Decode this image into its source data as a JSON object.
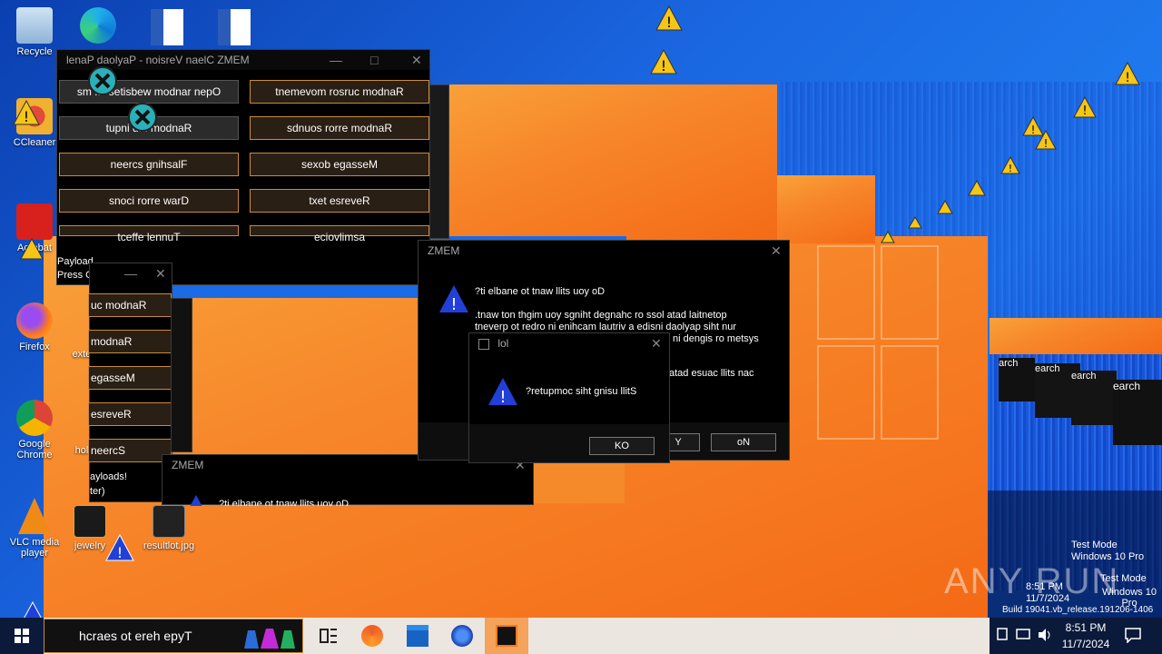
{
  "desktop": {
    "icons": [
      {
        "label": "Recycle"
      },
      {
        "label": "CCleaner"
      },
      {
        "label": "Acrobat"
      },
      {
        "label": "Firefox"
      },
      {
        "label": "Google Chrome"
      },
      {
        "label": "VLC media player"
      },
      {
        "label": "jewelry"
      },
      {
        "label": "resultlot.jpg"
      },
      {
        "label": "exte"
      },
      {
        "label": "hol"
      }
    ]
  },
  "memz_panel": {
    "title": "MEMZ Clean Version - Payload Panel",
    "title_display": "lenaP daolyaP - noisreV naelC ZMEM",
    "buttons": [
      "sm ... 'setisbew modnar nepO",
      "tnemevom rosruc modnaR",
      "tupni d... modnaR",
      "sdnuos rorre modnaR",
      "neercs gnihsalF",
      "sexob egasseM",
      "snoci rorre warD",
      "txet esreveR",
      "tceffe lennuT",
      "eciovlimsa"
    ],
    "footer_lines": [
      "Payload",
      "Press C"
    ]
  },
  "small_panel": {
    "buttons": [
      "uc modnaR",
      "modnaR",
      "egasseM",
      "esreveR",
      "neercS"
    ],
    "footer": [
      "ayloads!",
      "ter)"
    ]
  },
  "dialog_main": {
    "title": "ZMEM",
    "question": "?ti elbane ot tnaw llits uoy oD",
    "body_lines": [
      ".tnaw ton thgim uoy sgniht degnahc ro ssol atad laitnetop",
      "tneverp ot redro ni enihcam lautriv a edisni daolyap siht nur",
      "ni dengis ro metsys",
      "atad esuac llits nac"
    ],
    "yes_partial": "Y",
    "no_label": "oN"
  },
  "dialog_lol": {
    "title": "lol",
    "message": "?retupmoc siht gnisu llitS",
    "ok_label": "KO"
  },
  "dialog_bottom": {
    "title": "ZMEM",
    "question": "?ti elbane ot tnaw llits uoy oD"
  },
  "taskbar": {
    "search_placeholder": "hcraes ot ereh epyT",
    "time": "8:51 PM",
    "date": "11/7/2024"
  },
  "watermark": {
    "text": "ANY RUN",
    "test_mode_lines": [
      "Test Mode",
      "Windows 10 Pro",
      "Build 19041.vb_release.191206-1406"
    ]
  },
  "ghost_search": [
    "arch",
    "earch",
    "earch",
    "earch"
  ],
  "colors": {
    "accent_orange": "#f7862a",
    "button_border": "#c98b3c",
    "desktop_blue": "#1a66e0",
    "warning_blue": "#1f3fd8"
  }
}
